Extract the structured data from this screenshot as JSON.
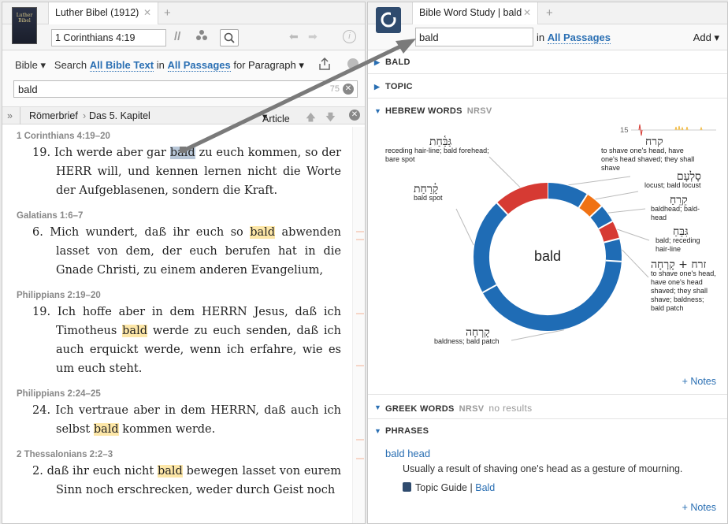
{
  "left": {
    "cover_text": "Luther Bibel",
    "tab_title": "Luther Bibel (1912)",
    "reference": "1 Corinthians 4:19",
    "search": {
      "scope_btn": "Bible",
      "search_label": "Search",
      "all_text": "All Bible Text",
      "in": "in",
      "all_passages": "All Passages",
      "for": "for",
      "paragraph": "Paragraph",
      "query": "bald",
      "count": "75"
    },
    "crumb": {
      "book": "Römerbrief",
      "chapter": "Das 5. Kapitel",
      "article": "Article"
    },
    "results": [
      {
        "ref": "1 Corinthians 4:19–20",
        "num": "19.",
        "before": "Ich werde aber gar ",
        "hit": "bald",
        "after": " zu euch kommen, so der HERR will, und kennen lernen nicht die Worte der Aufgeblasenen, sondern die Kraft.",
        "selected": true
      },
      {
        "ref": "Galatians 1:6–7",
        "num": "6.",
        "before": "Mich wundert, daß ihr euch so ",
        "hit": "bald",
        "after": " abwenden lasset von dem, der euch berufen hat in die Gnade Christi, zu einem anderen Evangelium,",
        "selected": false
      },
      {
        "ref": "Philippians 2:19–20",
        "num": "19.",
        "before": "Ich hoffe aber in dem HERRN Jesus, daß ich Timotheus ",
        "hit": "bald",
        "after": " werde zu euch senden, daß ich auch erquickt werde, wenn ich erfahre, wie es um euch steht.",
        "selected": false
      },
      {
        "ref": "Philippians 2:24–25",
        "num": "24.",
        "before": "Ich vertraue aber in dem HERRN, daß auch ich selbst ",
        "hit": "bald",
        "after": " kommen werde.",
        "selected": false
      },
      {
        "ref": "2 Thessalonians 2:2–3",
        "num": "2.",
        "before": "daß ihr euch nicht ",
        "hit": "bald",
        "after": " bewegen lasset von eurem Sinn noch erschrecken, weder durch Geist noch",
        "selected": false
      }
    ]
  },
  "right": {
    "tab_title": "Bible Word Study | bald",
    "query": "bald",
    "in": "in",
    "all_passages": "All Passages",
    "add": "Add",
    "sections": {
      "bald": "BALD",
      "topic": "TOPIC",
      "hebrew": "HEBREW WORDS",
      "hebrew_sub": "NRSV",
      "greek": "GREEK WORDS",
      "greek_sub": "NRSV",
      "greek_note": "no results",
      "phrases": "PHRASES"
    },
    "timeline_count": "15",
    "center_word": "bald",
    "hebrew_words": [
      {
        "heb": "גַּבַּ֫חַת",
        "gloss": "receding hair-line; bald forehead; bare spot"
      },
      {
        "heb": "קָ֫רַחַת",
        "gloss": "bald spot"
      },
      {
        "heb": "קָרְחָה",
        "gloss": "baldness; bald patch"
      },
      {
        "heb": "קרח",
        "gloss": "to shave one's head, have one's head shaved; they shall shave"
      },
      {
        "heb": "סָלְעָם",
        "gloss": "locust; bald locust"
      },
      {
        "heb": "קֵרֵחַ",
        "gloss": "baldhead; bald-head"
      },
      {
        "heb": "גִּבֵּחַ",
        "gloss": "bald; receding hair-line"
      },
      {
        "heb": "זרח + קָרְחָה",
        "gloss": "to shave one's head, have one's head shaved; they shall shave; baldness; bald patch"
      }
    ],
    "notes": "+ Notes",
    "phrase": {
      "title": "bald head",
      "definition": "Usually a result of shaving one's head as a gesture of mourning.",
      "guide_label": "Topic Guide",
      "guide_sep": "|",
      "guide_link": "Bald"
    },
    "chart_colors": {
      "blue": "#1f6cb5",
      "red": "#d63a33",
      "orange": "#f07214"
    }
  },
  "chart_data": {
    "type": "pie",
    "title": "",
    "center_label": "bald",
    "categories": [
      "קרח",
      "סָלְעָם",
      "קֵרֵחַ",
      "גִּבֵּחַ",
      "זרח + קָרְחָה",
      "קָרְחָה",
      "קָ֫רַחַת",
      "גַּבַּ֫חַת"
    ],
    "values": [
      9,
      4,
      4,
      4,
      5,
      41,
      21,
      12
    ]
  }
}
